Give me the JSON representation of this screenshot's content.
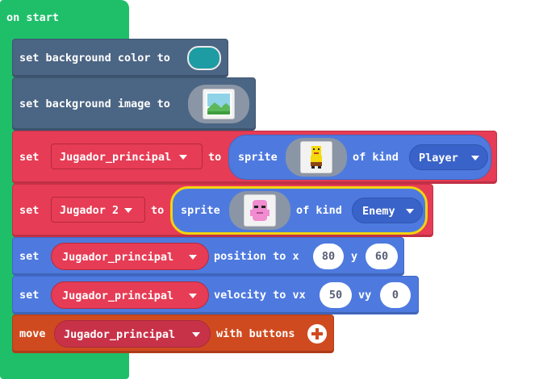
{
  "hat": {
    "label": "on start"
  },
  "blocks": {
    "bg_color": {
      "label": "set background color to",
      "color": "#1e9ca3"
    },
    "bg_image": {
      "label": "set background image to"
    },
    "set_player": {
      "set": "set",
      "variable": "Jugador_principal",
      "to": "to",
      "sprite": "sprite",
      "of_kind": "of kind",
      "kind": "Player"
    },
    "set_enemy": {
      "set": "set",
      "variable": "Jugador 2",
      "to": "to",
      "sprite": "sprite",
      "of_kind": "of kind",
      "kind": "Enemy"
    },
    "position": {
      "set": "set",
      "variable": "Jugador_principal",
      "label": "position to x",
      "x": "80",
      "y_label": "y",
      "y": "60"
    },
    "velocity": {
      "set": "set",
      "variable": "Jugador_principal",
      "label": "velocity to vx",
      "vx": "50",
      "vy_label": "vy",
      "vy": "0"
    },
    "move": {
      "label": "move",
      "variable": "Jugador_principal",
      "suffix": "with buttons"
    }
  },
  "colors": {
    "loops_green": "#1fbf6a",
    "scene_slate": "#4b6584",
    "sprites_red": "#e63c55",
    "sprites_blue": "#4e7adf",
    "controller_orange": "#d04a1f",
    "highlight_yellow": "#f2d40e"
  }
}
